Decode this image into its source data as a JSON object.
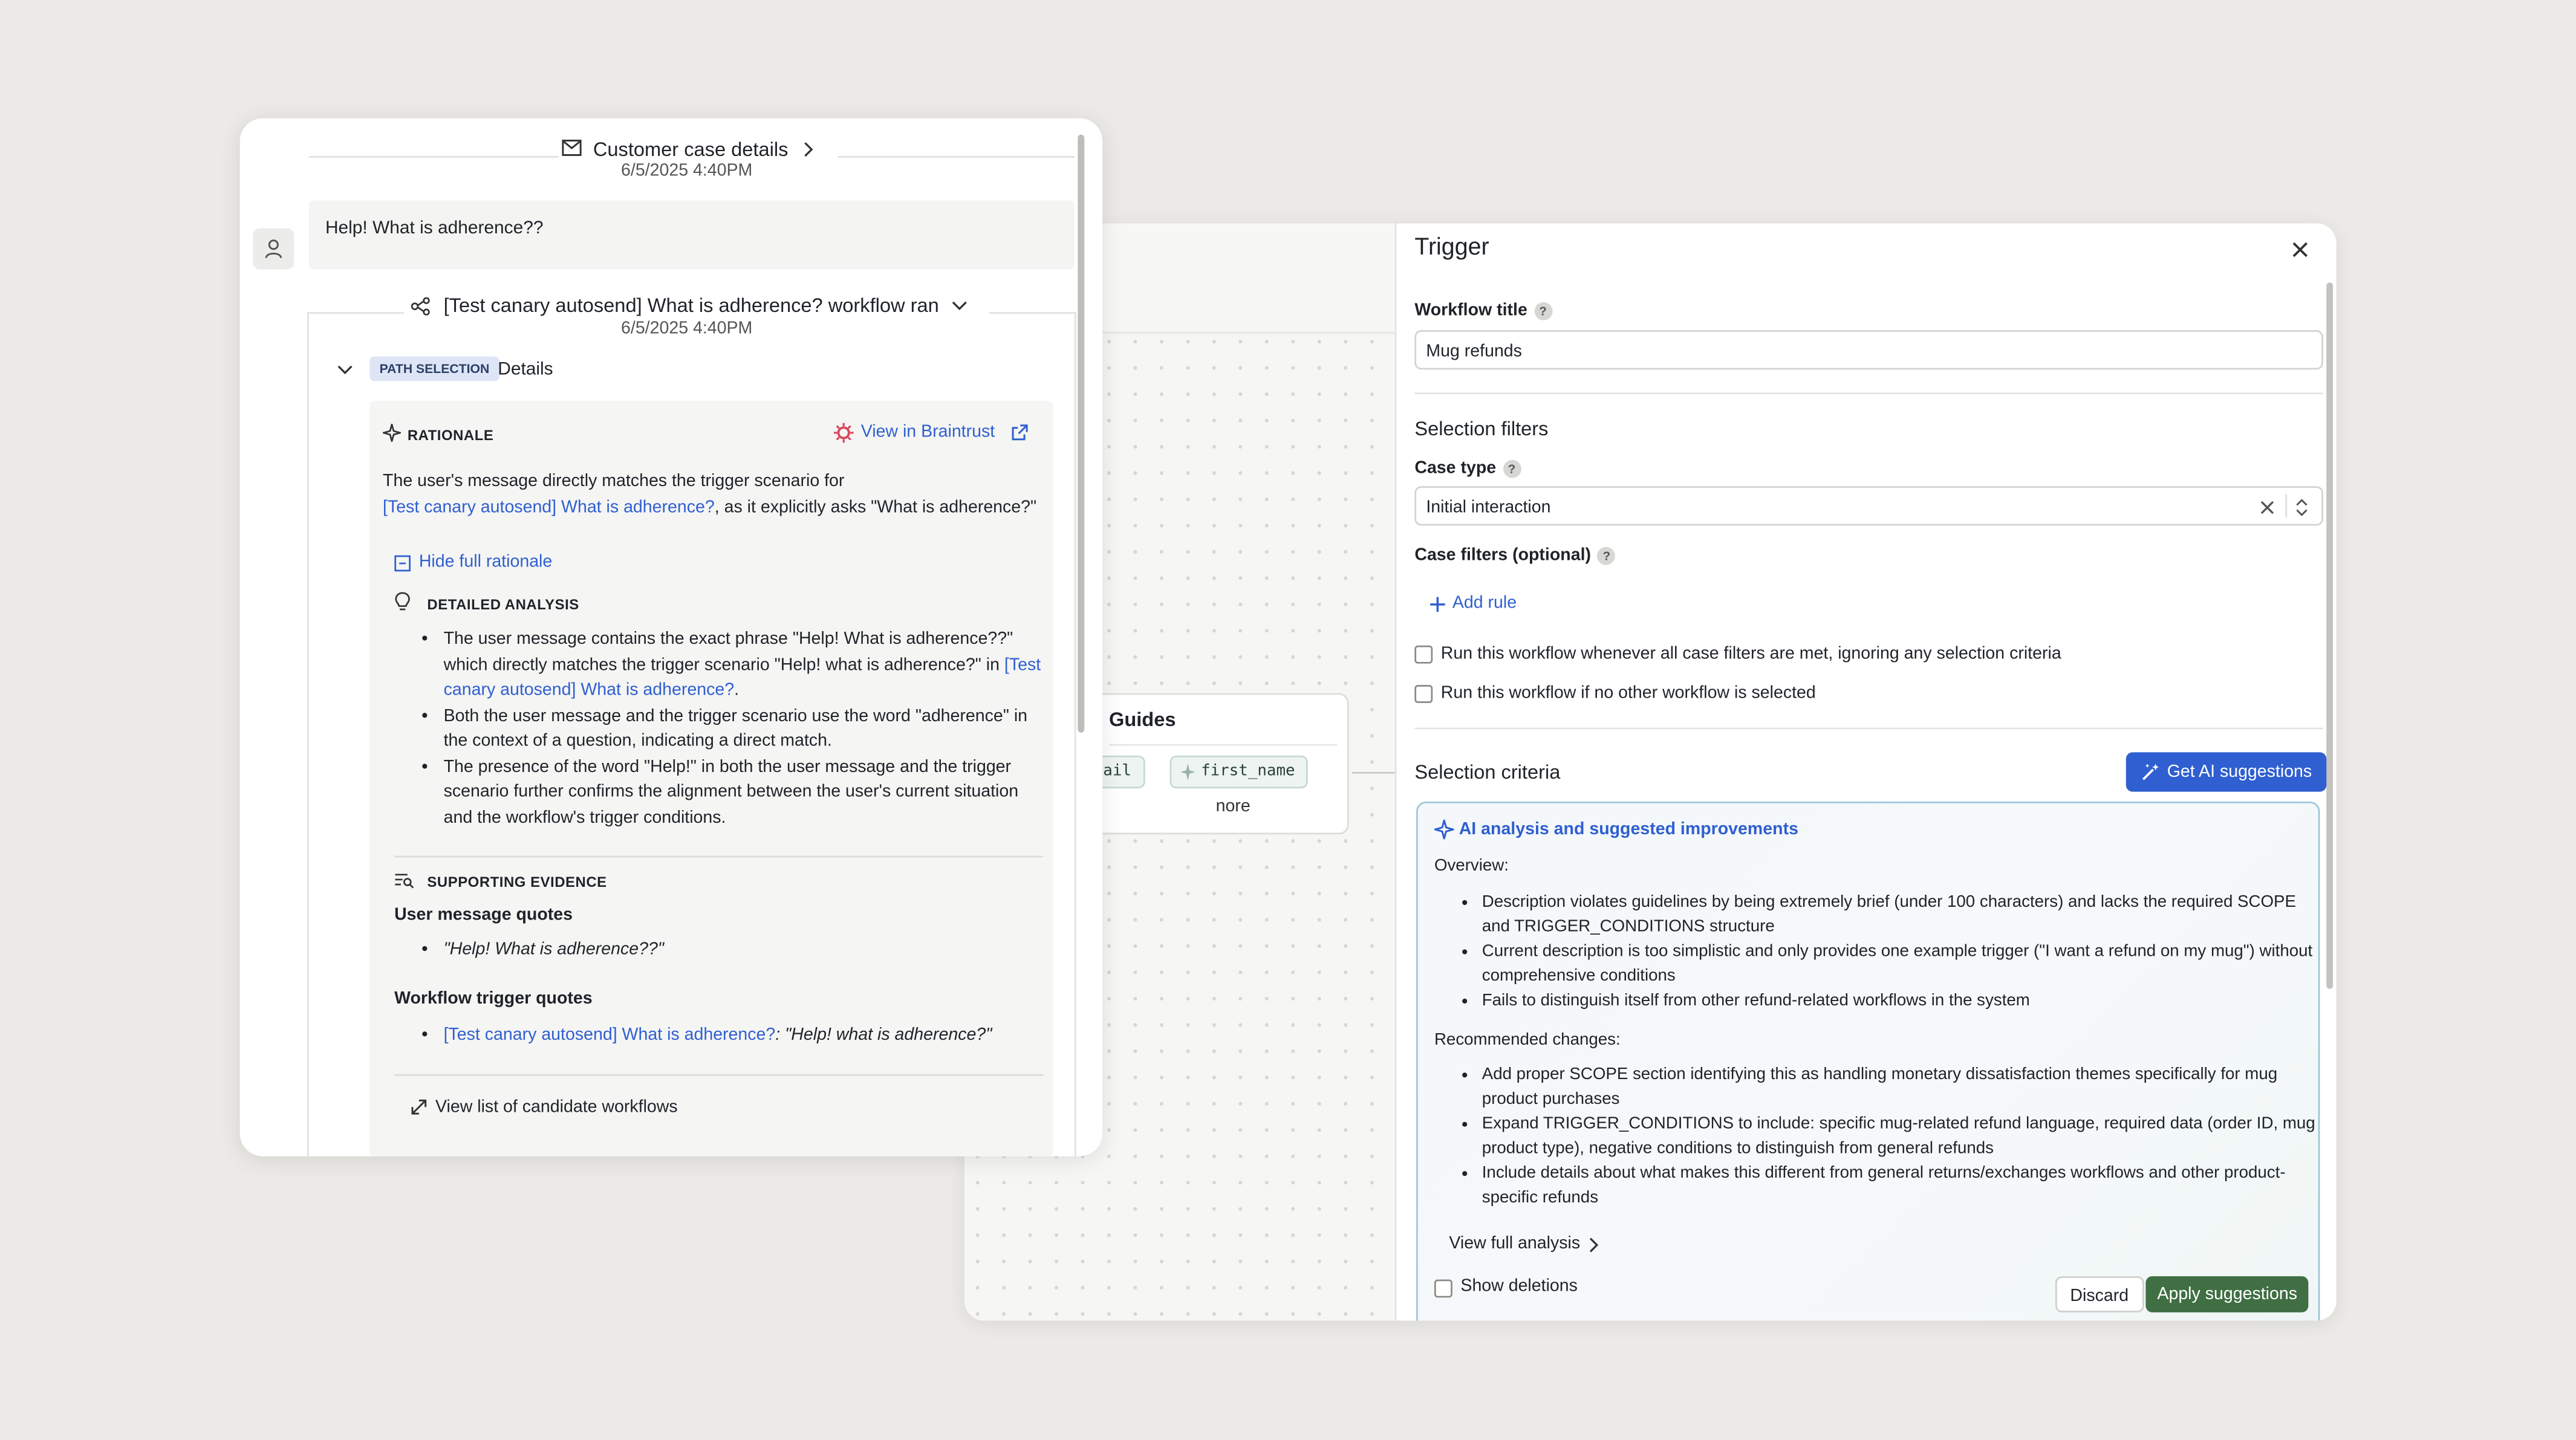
{
  "case_panel": {
    "header_title": "Customer case details",
    "header_date": "6/5/2025 4:40PM",
    "user_message": "Help! What is adherence??",
    "workflow_run_title": "[Test canary autosend] What is adherence? workflow ran",
    "workflow_run_date": "6/5/2025 4:40PM",
    "path_badge": "PATH SELECTION",
    "details_label": "Details",
    "rationale_heading": "RATIONALE",
    "braintrust_link": "View in Braintrust",
    "rationale_text_1": "The user's message directly matches the trigger scenario for",
    "rationale_link": "[Test canary autosend] What is adherence?",
    "rationale_text_2": ", as it explicitly asks \"What is adherence?\"",
    "hide_rationale": "Hide full rationale",
    "detailed_heading": "DETAILED ANALYSIS",
    "analysis_1a": "The user message contains the exact phrase \"Help! What is adherence??\" which directly matches the trigger scenario \"Help! what is adherence?\" in",
    "analysis_1_link": "[Test canary autosend] What is adherence?",
    "analysis_1b": ".",
    "analysis_2": "Both the user message and the trigger scenario use the word \"adherence\" in the context of a question, indicating a direct match.",
    "analysis_3": "The presence of the word \"Help!\" in both the user message and the trigger scenario further confirms the alignment between the user's current situation and the workflow's trigger conditions.",
    "evidence_heading": "SUPPORTING EVIDENCE",
    "user_quotes_heading": "User message quotes",
    "user_quote": "\"Help! What is adherence??\"",
    "workflow_quotes_heading": "Workflow trigger quotes",
    "workflow_quote_link": "[Test canary autosend] What is adherence?",
    "workflow_quote_text": ": \"Help! what is adherence?\"",
    "candidate_link": "View list of candidate workflows"
  },
  "canvas": {
    "guides_title": "Guides",
    "chips": [
      "email",
      "first_name"
    ],
    "more_label": "nore"
  },
  "trigger_panel": {
    "title": "Trigger",
    "workflow_title_label": "Workflow title",
    "workflow_title_value": "Mug refunds",
    "selection_filters": "Selection filters",
    "case_type_label": "Case type",
    "case_type_value": "Initial interaction",
    "case_filters_label": "Case filters (optional)",
    "add_rule": "Add rule",
    "checkbox_1": "Run this workflow whenever all case filters are met, ignoring any selection criteria",
    "checkbox_2": "Run this workflow if no other workflow is selected",
    "selection_criteria": "Selection criteria",
    "ai_button": "Get AI suggestions",
    "ai_title": "AI analysis and suggested improvements",
    "overview_label": "Overview:",
    "overview_items": [
      "Description violates guidelines by being extremely brief (under 100 characters) and lacks the required SCOPE and TRIGGER_CONDITIONS structure",
      "Current description is too simplistic and only provides one example trigger (\"I want a refund on my mug\") with­out comprehensive conditions",
      "Fails to distinguish itself from other refund-related workflows in the system"
    ],
    "recommended_label": "Recommended changes:",
    "recommended_items": [
      "Add proper SCOPE section identifying this as handling monetary dissatisfaction themes specifically for mug product purchases",
      "Expand TRIGGER_CONDITIONS to include: specific mug-related refund language, required data (order ID, mug product type), negative conditions to distinguish from general refunds",
      "Include details about what makes this different from general returns/exchanges workflows and other product-specific refunds"
    ],
    "view_full_analysis": "View full analysis",
    "show_deletions": "Show deletions",
    "discard": "Discard",
    "apply": "Apply suggestions"
  },
  "colors": {
    "background": "#eceae6",
    "link_blue": "#2f5fd0",
    "apply_green": "#3f6f43",
    "braintrust_red": "#d9475a"
  },
  "icons": [
    "mail-icon",
    "chevron-right-icon",
    "user-icon",
    "workflow-icon",
    "chevron-down-icon",
    "sparkle-icon",
    "braintrust-logo-icon",
    "external-link-icon",
    "collapse-icon",
    "lightbulb-icon",
    "evidence-icon",
    "expand-icon",
    "help-icon",
    "close-icon",
    "clear-icon",
    "select-arrows-icon",
    "plus-icon",
    "magic-wand-icon"
  ]
}
